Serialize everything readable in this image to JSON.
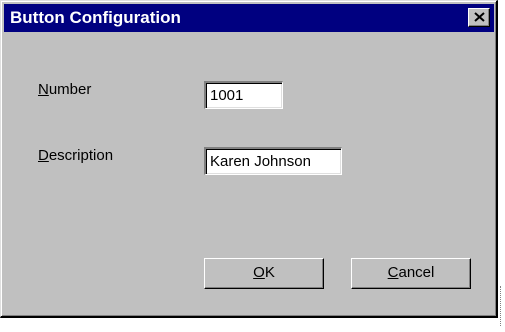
{
  "dialog": {
    "title": "Button Configuration",
    "close_icon": "close-icon"
  },
  "fields": {
    "number": {
      "label_mnemonic": "N",
      "label_rest": "umber",
      "value": "1001"
    },
    "description": {
      "label_mnemonic": "D",
      "label_rest": "escription",
      "value": "Karen Johnson"
    }
  },
  "buttons": {
    "ok": {
      "mnemonic": "O",
      "rest": "K"
    },
    "cancel": {
      "mnemonic": "C",
      "rest": "ancel"
    }
  },
  "colors": {
    "titlebar": "#000080",
    "face": "#c0c0c0"
  }
}
